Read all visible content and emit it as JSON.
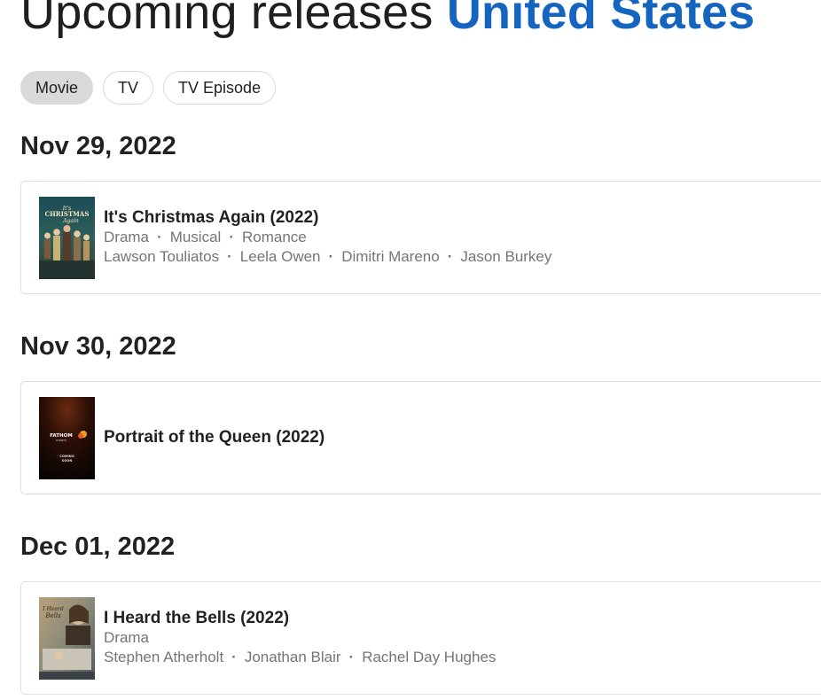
{
  "header": {
    "title_prefix": "Upcoming releases",
    "region": "United States"
  },
  "filters": {
    "items": [
      {
        "label": "Movie",
        "selected": true
      },
      {
        "label": "TV",
        "selected": false
      },
      {
        "label": "TV Episode",
        "selected": false
      }
    ]
  },
  "groups": [
    {
      "date": "Nov 29, 2022",
      "movie": {
        "title": "It's Christmas Again (2022)",
        "genres": [
          "Drama",
          "Musical",
          "Romance"
        ],
        "cast": [
          "Lawson Touliatos",
          "Leela Owen",
          "Dimitri Mareno",
          "Jason Burkey"
        ],
        "poster_icon": "christmas-poster-icon",
        "poster_text": "It's Christmas Again"
      }
    },
    {
      "date": "Nov 30, 2022",
      "movie": {
        "title": "Portrait of the Queen (2022)",
        "genres": [],
        "cast": [],
        "poster_icon": "fathom-poster-icon",
        "poster_text_top": "FATHOM",
        "poster_text_sub": "EVENTS",
        "poster_text_bottom": "COMING SOON"
      }
    },
    {
      "date": "Dec 01, 2022",
      "movie": {
        "title": "I Heard the Bells (2022)",
        "genres": [
          "Drama"
        ],
        "cast": [
          "Stephen Atherholt",
          "Jonathan Blair",
          "Rachel Day Hughes"
        ],
        "poster_icon": "bells-poster-icon",
        "poster_text": "I Heard the Bells"
      }
    }
  ],
  "colors": {
    "accent": "#1565c0",
    "chip_selected_bg": "#d9d9d9",
    "meta_text": "#757575"
  }
}
